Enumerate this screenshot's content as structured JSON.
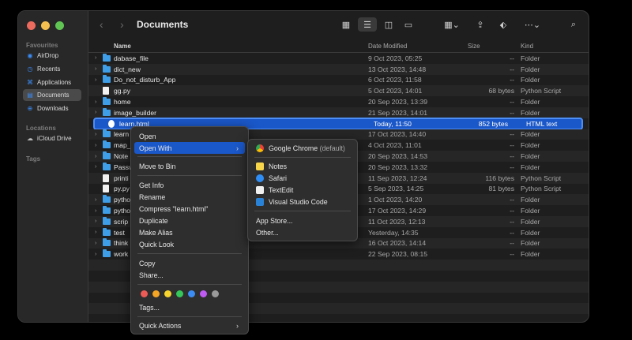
{
  "window": {
    "title": "Documents"
  },
  "sidebar": {
    "favourites_label": "Favourites",
    "locations_label": "Locations",
    "tags_label": "Tags",
    "items": [
      {
        "label": "AirDrop",
        "icon": "airdrop-icon"
      },
      {
        "label": "Recents",
        "icon": "clock-icon"
      },
      {
        "label": "Applications",
        "icon": "applications-icon"
      },
      {
        "label": "Documents",
        "icon": "document-icon",
        "selected": true
      },
      {
        "label": "Downloads",
        "icon": "download-icon"
      }
    ],
    "locations": [
      {
        "label": "iCloud Drive",
        "icon": "cloud-icon"
      }
    ]
  },
  "columns": {
    "name": "Name",
    "date": "Date Modified",
    "size": "Size",
    "kind": "Kind"
  },
  "files": [
    {
      "name": "dabase_file",
      "date": "9 Oct 2023, 05:25",
      "size": "--",
      "kind": "Folder",
      "type": "folder"
    },
    {
      "name": "dict_new",
      "date": "13 Oct 2023, 14:48",
      "size": "--",
      "kind": "Folder",
      "type": "folder"
    },
    {
      "name": "Do_not_disturb_App",
      "date": "6 Oct 2023, 11:58",
      "size": "--",
      "kind": "Folder",
      "type": "folder"
    },
    {
      "name": "gg.py",
      "date": "5 Oct 2023, 14:01",
      "size": "68 bytes",
      "kind": "Python Script",
      "type": "file"
    },
    {
      "name": "home",
      "date": "20 Sep 2023, 13:39",
      "size": "--",
      "kind": "Folder",
      "type": "folder"
    },
    {
      "name": "image_builder",
      "date": "21 Sep 2023, 14:01",
      "size": "--",
      "kind": "Folder",
      "type": "folder"
    },
    {
      "name": "learn.html",
      "date": "Today, 11:50",
      "size": "852 bytes",
      "kind": "HTML text",
      "type": "html",
      "selected": true
    },
    {
      "name": "learn",
      "date": "17 Oct 2023, 14:40",
      "size": "--",
      "kind": "Folder",
      "type": "folder"
    },
    {
      "name": "map_",
      "date": "4 Oct 2023, 11:01",
      "size": "--",
      "kind": "Folder",
      "type": "folder"
    },
    {
      "name": "Note",
      "date": "20 Sep 2023, 14:53",
      "size": "--",
      "kind": "Folder",
      "type": "folder"
    },
    {
      "name": "Passw",
      "date": "20 Sep 2023, 13:32",
      "size": "--",
      "kind": "Folder",
      "type": "folder"
    },
    {
      "name": "printi",
      "date": "11 Sep 2023, 12:24",
      "size": "116 bytes",
      "kind": "Python Script",
      "type": "file"
    },
    {
      "name": "py.py",
      "date": "5 Sep 2023, 14:25",
      "size": "81 bytes",
      "kind": "Python Script",
      "type": "file"
    },
    {
      "name": "pytho",
      "date": "1 Oct 2023, 14:20",
      "size": "--",
      "kind": "Folder",
      "type": "folder"
    },
    {
      "name": "pytho",
      "date": "17 Oct 2023, 14:29",
      "size": "--",
      "kind": "Folder",
      "type": "folder"
    },
    {
      "name": "scrip",
      "date": "11 Oct 2023, 12:13",
      "size": "--",
      "kind": "Folder",
      "type": "folder"
    },
    {
      "name": "test",
      "date": "Yesterday, 14:35",
      "size": "--",
      "kind": "Folder",
      "type": "folder"
    },
    {
      "name": "think",
      "date": "16 Oct 2023, 14:14",
      "size": "--",
      "kind": "Folder",
      "type": "folder"
    },
    {
      "name": "work",
      "date": "22 Sep 2023, 08:15",
      "size": "--",
      "kind": "Folder",
      "type": "folder"
    }
  ],
  "context_menu": {
    "open": "Open",
    "open_with": "Open With",
    "move_to_bin": "Move to Bin",
    "get_info": "Get Info",
    "rename": "Rename",
    "compress": "Compress \"learn.html\"",
    "duplicate": "Duplicate",
    "make_alias": "Make Alias",
    "quick_look": "Quick Look",
    "copy": "Copy",
    "share": "Share...",
    "tags": "Tags...",
    "quick_actions": "Quick Actions",
    "tag_colors": [
      "#ec5b56",
      "#f5a524",
      "#f6d32d",
      "#35c759",
      "#3b8cf5",
      "#bf5af2",
      "#9a9a9a"
    ]
  },
  "open_with_menu": {
    "default_app": "Google Chrome",
    "default_suffix": "(default)",
    "apps": [
      "Notes",
      "Safari",
      "TextEdit",
      "Visual Studio Code"
    ],
    "app_store": "App Store...",
    "other": "Other..."
  },
  "colors": {
    "accent": "#1a57c8",
    "folder": "#3f9ee8"
  }
}
